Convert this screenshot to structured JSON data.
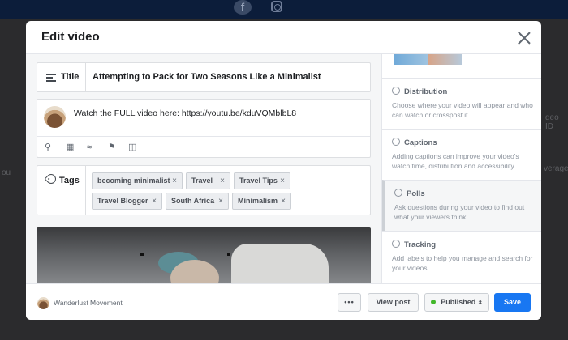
{
  "background": {
    "left_fragment": "ou",
    "right_fragment_1": "deo ID",
    "right_fragment_2": "verage"
  },
  "modal": {
    "title": "Edit video",
    "title_field": {
      "label": "Title",
      "value": "Attempting to Pack for Two Seasons Like a Minimalist"
    },
    "description": {
      "text": "Watch the FULL video here: https://youtu.be/kduVQMblbL8",
      "icons": [
        "location-icon",
        "calendar-icon",
        "handshake-icon",
        "flag-icon",
        "briefcase-icon"
      ]
    },
    "tags": {
      "label": "Tags",
      "items": [
        {
          "label": "becoming minimalist"
        },
        {
          "label": "Travel"
        },
        {
          "label": "Travel Tips"
        },
        {
          "label": "Travel Blogger"
        },
        {
          "label": "South Africa"
        },
        {
          "label": "Minimalism"
        }
      ],
      "remove_glyph": "×"
    },
    "sidebar": {
      "sections": [
        {
          "title": "Distribution",
          "description": "Choose where your video will appear and who can watch or crosspost it."
        },
        {
          "title": "Captions",
          "description": "Adding captions can improve your video's watch time, distribution and accessibility."
        },
        {
          "title": "Polls",
          "description": "Ask questions during your video to find out what your viewers think."
        },
        {
          "title": "Tracking",
          "description": "Add labels to help you manage and search for your videos."
        }
      ]
    },
    "footer": {
      "page_name": "Wanderlust Movement",
      "more_label": "•••",
      "view_post_label": "View post",
      "status_label": "Published",
      "status_arrow": "⬍",
      "save_label": "Save"
    }
  },
  "colors": {
    "accent": "#1877f2",
    "published_dot": "#42b72a"
  }
}
